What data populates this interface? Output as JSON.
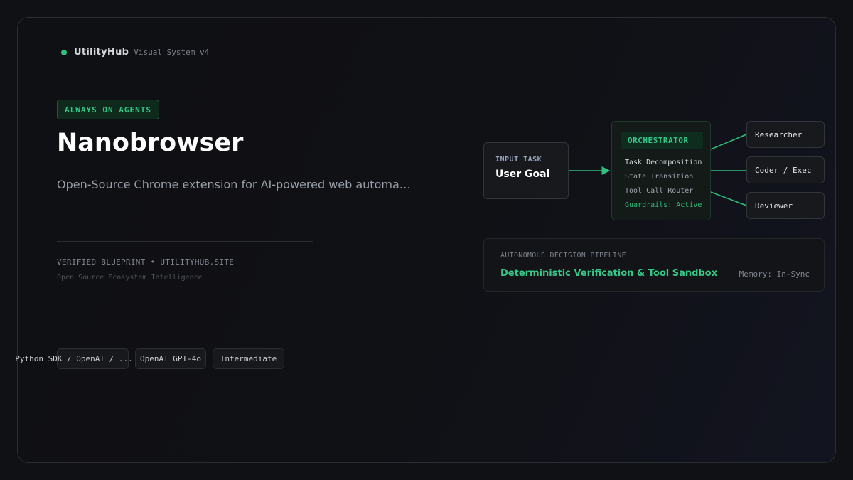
{
  "brand": {
    "name": "UtilityHub",
    "subtitle": "Visual System v4"
  },
  "hero": {
    "badge": "ALWAYS ON AGENTS",
    "title": "Nanobrowser",
    "description": "Open-Source Chrome extension for AI-powered web automa…",
    "verified": "VERIFIED BLUEPRINT • UTILITYHUB.SITE",
    "ecosystem": "Open Source Ecosystem Intelligence"
  },
  "tags": [
    "Python SDK / OpenAI / ...",
    "OpenAI GPT-4o",
    "Intermediate"
  ],
  "diagram": {
    "input": {
      "label": "INPUT TASK",
      "title": "User Goal"
    },
    "orchestrator": {
      "label": "ORCHESTRATOR",
      "items": [
        "Task Decomposition",
        "State Transition",
        "Tool Call Router",
        "Guardrails: Active"
      ]
    },
    "agents": [
      "Researcher",
      "Coder / Exec",
      "Reviewer"
    ],
    "pipeline": {
      "label": "AUTONOMOUS DECISION PIPELINE",
      "title": "Deterministic Verification & Tool Sandbox",
      "memory": "Memory: In-Sync"
    }
  },
  "colors": {
    "accent": "#2ec07c",
    "background": "#101114"
  }
}
